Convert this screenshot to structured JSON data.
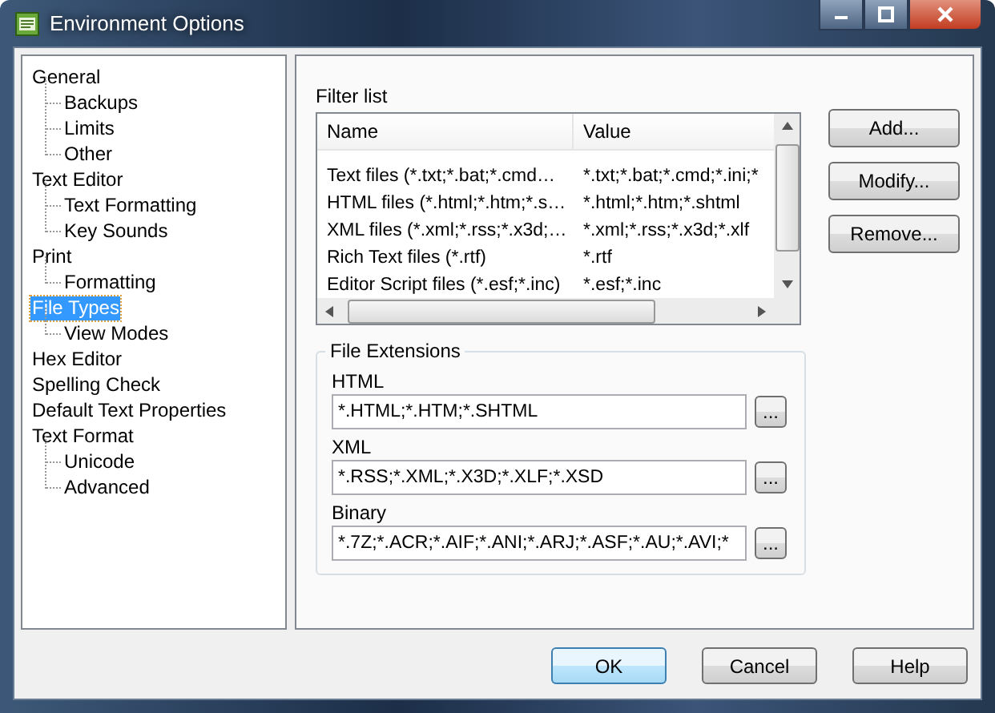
{
  "window": {
    "title": "Environment Options"
  },
  "tree": [
    {
      "label": "General",
      "selected": false,
      "children": [
        {
          "label": "Backups",
          "selected": false
        },
        {
          "label": "Limits",
          "selected": false
        },
        {
          "label": "Other",
          "selected": false
        }
      ]
    },
    {
      "label": "Text Editor",
      "selected": false,
      "children": [
        {
          "label": "Text Formatting",
          "selected": false
        },
        {
          "label": "Key Sounds",
          "selected": false
        }
      ]
    },
    {
      "label": "Print",
      "selected": false,
      "children": [
        {
          "label": "Formatting",
          "selected": false
        }
      ]
    },
    {
      "label": "File Types",
      "selected": true,
      "children": [
        {
          "label": "View Modes",
          "selected": false
        }
      ]
    },
    {
      "label": "Hex Editor",
      "selected": false
    },
    {
      "label": "Spelling Check",
      "selected": false
    },
    {
      "label": "Default Text Properties",
      "selected": false
    },
    {
      "label": "Text Format",
      "selected": false,
      "children": [
        {
          "label": "Unicode",
          "selected": false
        },
        {
          "label": "Advanced",
          "selected": false
        }
      ]
    }
  ],
  "filter_list": {
    "label": "Filter list",
    "columns": [
      "Name",
      "Value"
    ],
    "rows": [
      [
        "Text files (*.txt;*.bat;*.cmd…",
        "*.txt;*.bat;*.cmd;*.ini;*"
      ],
      [
        "HTML files (*.html;*.htm;*.s…",
        "*.html;*.htm;*.shtml"
      ],
      [
        "XML files (*.xml;*.rss;*.x3d;…",
        "*.xml;*.rss;*.x3d;*.xlf"
      ],
      [
        "Rich Text files (*.rtf)",
        "*.rtf"
      ],
      [
        "Editor Script files (*.esf;*.inc)",
        "*.esf;*.inc"
      ]
    ]
  },
  "side_buttons": [
    "Add...",
    "Modify...",
    "Remove..."
  ],
  "file_extensions": {
    "title": "File Extensions",
    "fields": [
      {
        "label": "HTML",
        "value": "*.HTML;*.HTM;*.SHTML",
        "button": "..."
      },
      {
        "label": "XML",
        "value": "*.RSS;*.XML;*.X3D;*.XLF;*.XSD",
        "button": "..."
      },
      {
        "label": "Binary",
        "value": "*.7Z;*.ACR;*.AIF;*.ANI;*.ARJ;*.ASF;*.AU;*.AVI;*",
        "button": "..."
      }
    ]
  },
  "buttons": [
    {
      "label": "OK",
      "default": true
    },
    {
      "label": "Cancel",
      "default": false
    },
    {
      "label": "Help",
      "default": false
    }
  ]
}
